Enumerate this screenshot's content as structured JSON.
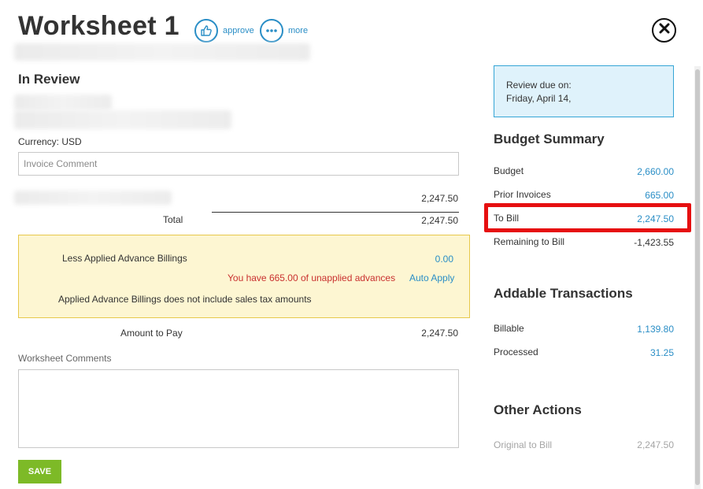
{
  "header": {
    "title": "Worksheet 1",
    "approve_label": "approve",
    "more_label": "more"
  },
  "status": "In Review",
  "currency": "Currency: USD",
  "invoice_comment": {
    "placeholder": "Invoice Comment",
    "value": ""
  },
  "line_item_value": "2,247.50",
  "total": {
    "label": "Total",
    "value": "2,247.50"
  },
  "advance": {
    "label": "Less Applied Advance Billings",
    "value": "0.00",
    "warning": "You have 665.00 of unapplied advances",
    "auto_apply_label": "Auto Apply",
    "note": "Applied Advance Billings does not include sales tax amounts"
  },
  "amount_to_pay": {
    "label": "Amount to Pay",
    "value": "2,247.50"
  },
  "worksheet_comments": {
    "label": "Worksheet Comments",
    "value": ""
  },
  "save_label": "SAVE",
  "review_due": {
    "line1": "Review due on:",
    "line2": "Friday, April 14,"
  },
  "budget_summary": {
    "title": "Budget Summary",
    "rows": [
      {
        "label": "Budget",
        "value": "2,660.00"
      },
      {
        "label": "Prior Invoices",
        "value": "665.00"
      },
      {
        "label": "To Bill",
        "value": "2,247.50"
      },
      {
        "label": "Remaining to Bill",
        "value": "-1,423.55"
      }
    ]
  },
  "addable_transactions": {
    "title": "Addable Transactions",
    "rows": [
      {
        "label": "Billable",
        "value": "1,139.80"
      },
      {
        "label": "Processed",
        "value": "31.25"
      }
    ]
  },
  "other_actions": {
    "title": "Other Actions",
    "rows": [
      {
        "label": "Original to Bill",
        "value": "2,247.50"
      }
    ]
  },
  "colors": {
    "accent": "#2a8ec6",
    "save": "#7dba27",
    "warning": "#c9312f",
    "advance_bg": "#fdf6d2",
    "due_bg": "#dff2fb",
    "highlight": "#e60f10"
  },
  "icons": {
    "approve": "thumbs-up-icon",
    "more": "ellipsis-icon",
    "close": "close-icon"
  }
}
